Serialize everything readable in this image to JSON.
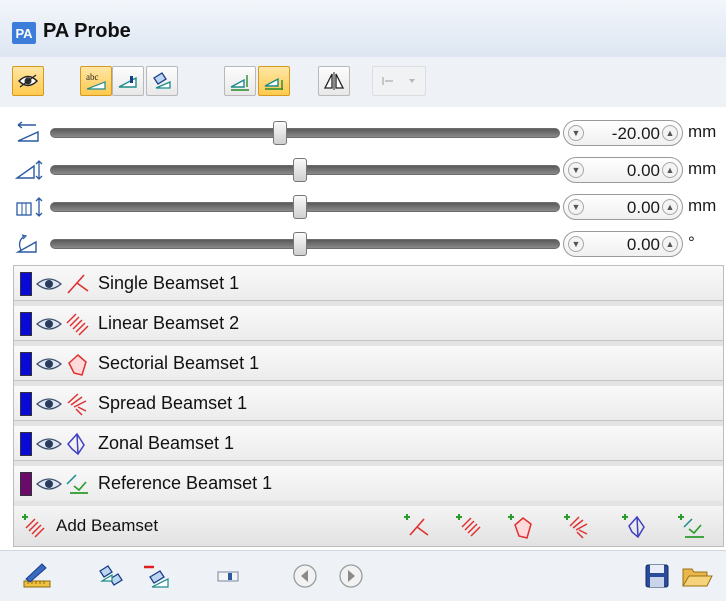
{
  "window": {
    "badge": "PA",
    "title": "PA Probe"
  },
  "toolbar": {
    "buttons": [
      {
        "icon": "eye-view-icon",
        "state": "active"
      },
      {
        "icon": "abc-label-icon",
        "state": "active"
      },
      {
        "icon": "wedge-icon",
        "state": "normal"
      },
      {
        "icon": "probe-tilt-icon",
        "state": "normal"
      },
      {
        "icon": "wedge-index-icon",
        "state": "normal"
      },
      {
        "icon": "wedge-offset-icon",
        "state": "active"
      },
      {
        "icon": "mirror-icon",
        "state": "normal"
      },
      {
        "icon": "dropdown-disabled-icon",
        "state": "disabled"
      }
    ]
  },
  "sliders": [
    {
      "icon": "index-offset-icon",
      "value": "-20.00",
      "unit": "mm",
      "position_fraction": 0.45
    },
    {
      "icon": "wedge-height-icon",
      "value": "0.00",
      "unit": "mm",
      "position_fraction": 0.49
    },
    {
      "icon": "lateral-offset-icon",
      "value": "0.00",
      "unit": "mm",
      "position_fraction": 0.49
    },
    {
      "icon": "skew-angle-icon",
      "value": "0.00",
      "unit": "°",
      "position_fraction": 0.49
    }
  ],
  "beamsets": [
    {
      "label": "Single Beamset 1",
      "color": "#0a0ad6",
      "type_icon": "single-beam-icon"
    },
    {
      "label": "Linear Beamset 2",
      "color": "#0a0ad6",
      "type_icon": "linear-beam-icon"
    },
    {
      "label": "Sectorial Beamset 1",
      "color": "#0a0ad6",
      "type_icon": "sectorial-beam-icon"
    },
    {
      "label": "Spread Beamset 1",
      "color": "#0a0ad6",
      "type_icon": "spread-beam-icon"
    },
    {
      "label": "Zonal Beamset 1",
      "color": "#0a0ad6",
      "type_icon": "zonal-beam-icon"
    },
    {
      "label": "Reference Beamset 1",
      "color": "#6a0a6a",
      "type_icon": "reference-beam-icon"
    }
  ],
  "add_beamset": {
    "label": "Add Beamset",
    "type_buttons": [
      "add-single-icon",
      "add-linear-icon",
      "add-sectorial-icon",
      "add-spread-icon",
      "add-zonal-icon",
      "add-reference-icon"
    ]
  },
  "bottom_bar": {
    "icons": [
      "edit-ruler-icon",
      "copy-probe-icon",
      "remove-probe-icon",
      "element-icon",
      "prev-icon",
      "next-icon",
      "save-icon",
      "open-folder-icon"
    ]
  }
}
